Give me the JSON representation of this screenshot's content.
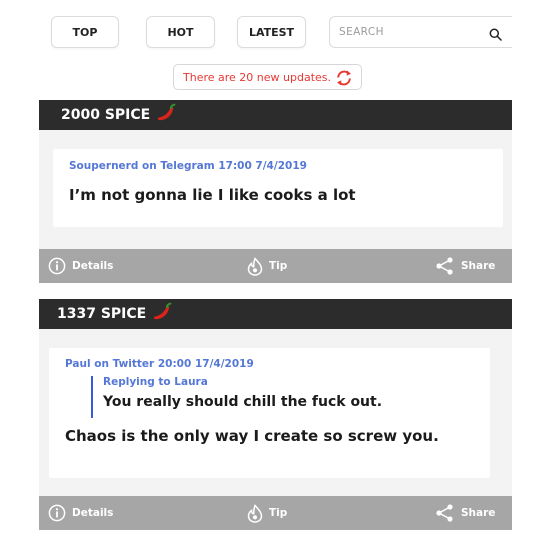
{
  "nav": {
    "top_label": "TOP",
    "hot_label": "HOT",
    "latest_label": "LATEST",
    "search_placeholder": "SEARCH"
  },
  "updates_text": "There are 20 new updates.",
  "colors": {
    "header_bg": "#2c2c2c",
    "footer_bg": "#a6a6a6",
    "accent_blue": "#5577d6",
    "update_red": "#e53935"
  },
  "icons": {
    "search": "search-icon",
    "refresh": "refresh-icon",
    "chili": "chili-pepper-icon",
    "info": "info-icon",
    "tip": "flame-icon",
    "share": "share-icon"
  },
  "posts": [
    {
      "spice": "2000 SPICE",
      "meta": "Soupernerd on Telegram 17:00 7/4/2019",
      "message": "I’m not gonna lie I like cooks a lot",
      "footer": {
        "details": "Details",
        "tip": "Tip",
        "share": "Share"
      }
    },
    {
      "spice": "1337 SPICE",
      "meta": "Paul on Twitter 20:00 17/4/2019",
      "reply_to": "Replying to Laura",
      "reply_text": "You really should chill the fuck out.",
      "message": "Chaos is the only way I create so screw you.",
      "footer": {
        "details": "Details",
        "tip": "Tip",
        "share": "Share"
      }
    }
  ]
}
